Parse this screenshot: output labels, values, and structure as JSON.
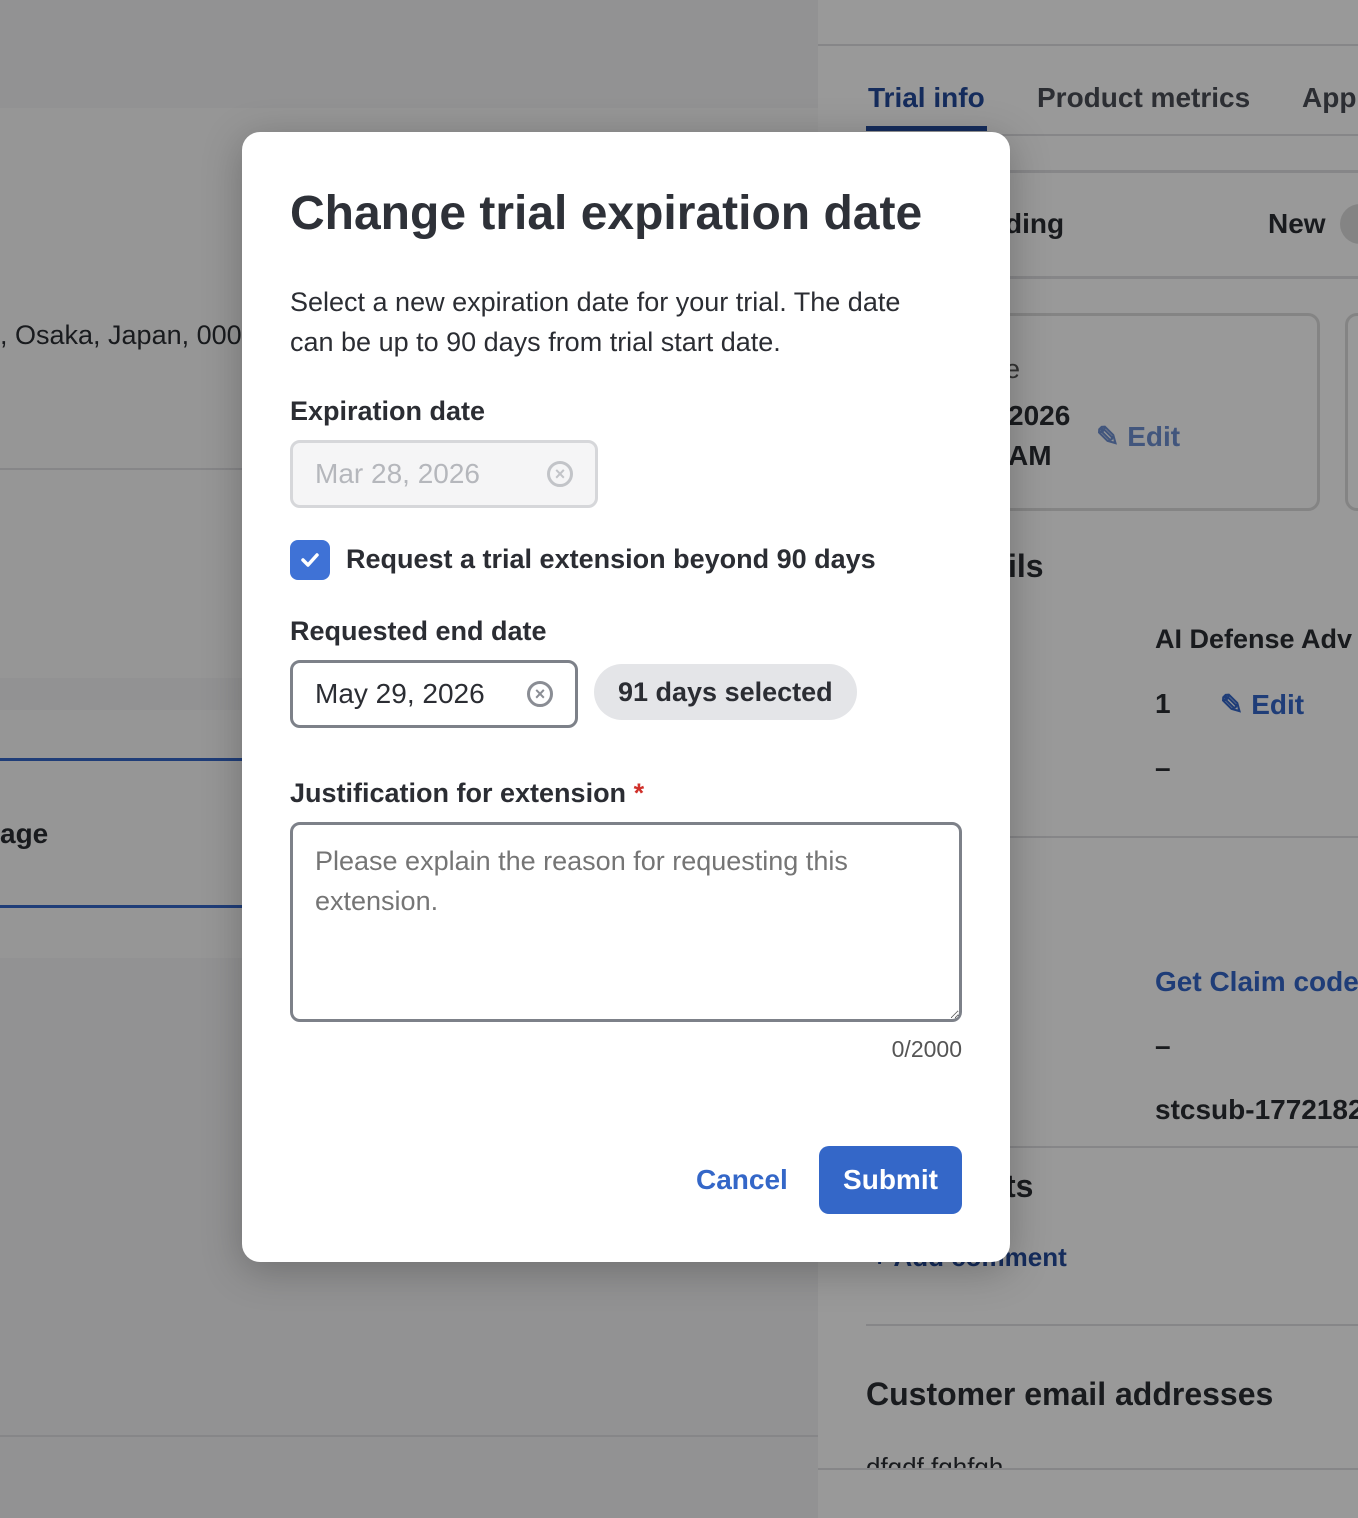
{
  "background": {
    "address_fragment": ", Osaka, Japan, 000",
    "left_fragment": "age",
    "tabs": [
      "Trial info",
      "Product metrics",
      "App"
    ],
    "status_fragment": "ding",
    "status_badge": "New",
    "card_label_fragment": "e",
    "card_date_fragment": "2026",
    "card_time_fragment": "AM",
    "edit_label": "Edit",
    "details_fragment": "ils",
    "product_name": "AI Defense Adv",
    "quantity": "1",
    "dash": "–",
    "claim_link": "Get Claim code",
    "subscription_id": "stcsub-1772182",
    "comments_fragment": "ts",
    "add_comment": "Add comment",
    "emails_heading": "Customer email addresses",
    "email_fragment": "dfgdf fghfgh"
  },
  "modal": {
    "title": "Change trial expiration date",
    "description": "Select a new expiration date for your trial. The date can be up to 90 days from trial start date.",
    "expiration_label": "Expiration date",
    "expiration_value": "Mar 28, 2026",
    "checkbox_label": "Request a trial extension beyond 90 days",
    "checkbox_checked": true,
    "requested_label": "Requested end date",
    "requested_value": "May 29, 2026",
    "days_badge": "91 days selected",
    "justification_label": "Justification for extension",
    "required_mark": "*",
    "justification_placeholder": "Please explain the reason for requesting this extension.",
    "char_count": "0/2000",
    "cancel": "Cancel",
    "submit": "Submit"
  },
  "colors": {
    "primary": "#3467c8",
    "overlay": "rgba(0,0,0,0.4)"
  }
}
